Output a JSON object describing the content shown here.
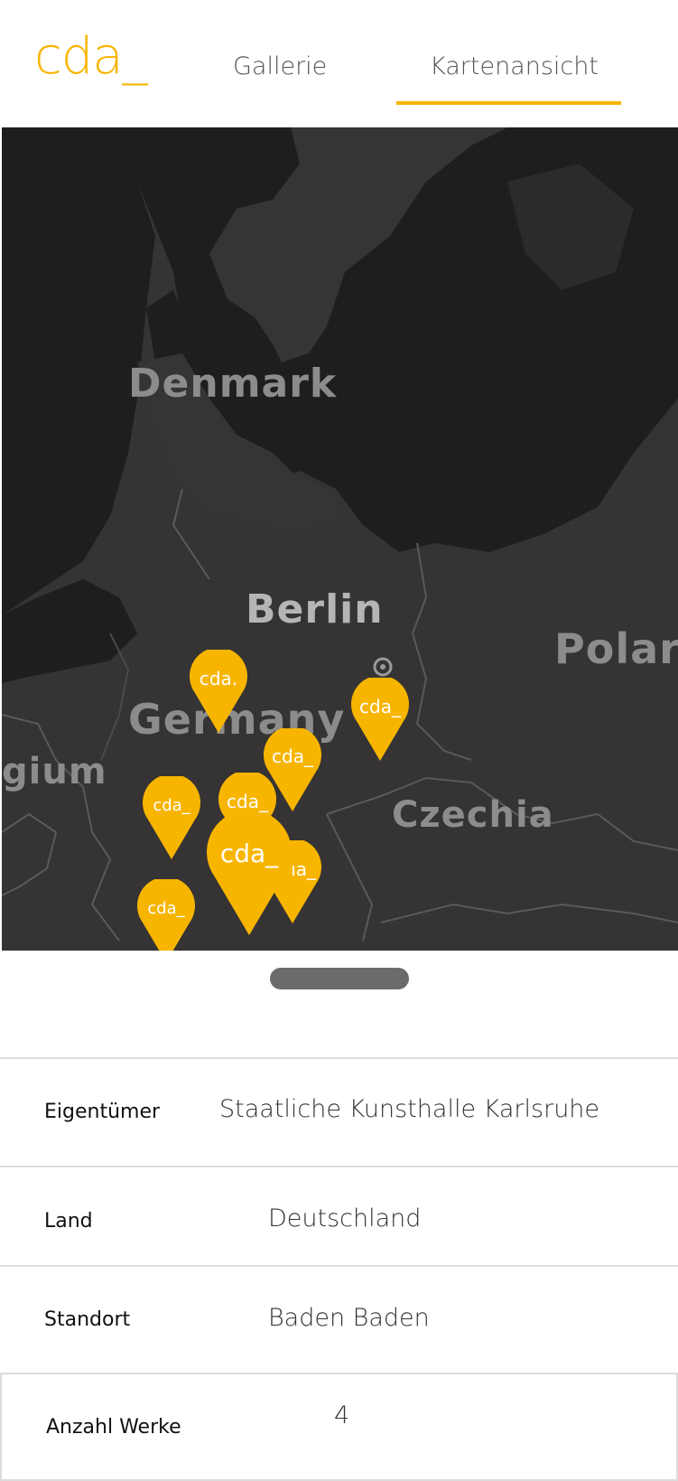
{
  "header": {
    "logo": "cda_",
    "tabs": [
      {
        "label": "Gallerie",
        "active": false
      },
      {
        "label": "Kartenansicht",
        "active": true
      }
    ],
    "accent_color": "#f7b500"
  },
  "map": {
    "labels": {
      "denmark": "Denmark",
      "berlin": "Berlin",
      "germany": "Germany",
      "poland": "Polar",
      "belgium": "gium",
      "czechia": "Czechia"
    },
    "pins": [
      {
        "label": "cda."
      },
      {
        "label": "cda_"
      },
      {
        "label": "cda_"
      },
      {
        "label": "cda_"
      },
      {
        "label": "cda_"
      },
      {
        "label": "ıa_"
      },
      {
        "label": "cda_"
      },
      {
        "label": "cda_"
      }
    ]
  },
  "details": {
    "rows": [
      {
        "label": "Eigentümer",
        "value": "Staatliche Kunsthalle Karlsruhe"
      },
      {
        "label": "Land",
        "value": "Deutschland"
      },
      {
        "label": "Standort",
        "value": "Baden Baden"
      },
      {
        "label": "Anzahl Werke",
        "value": "4"
      }
    ]
  }
}
